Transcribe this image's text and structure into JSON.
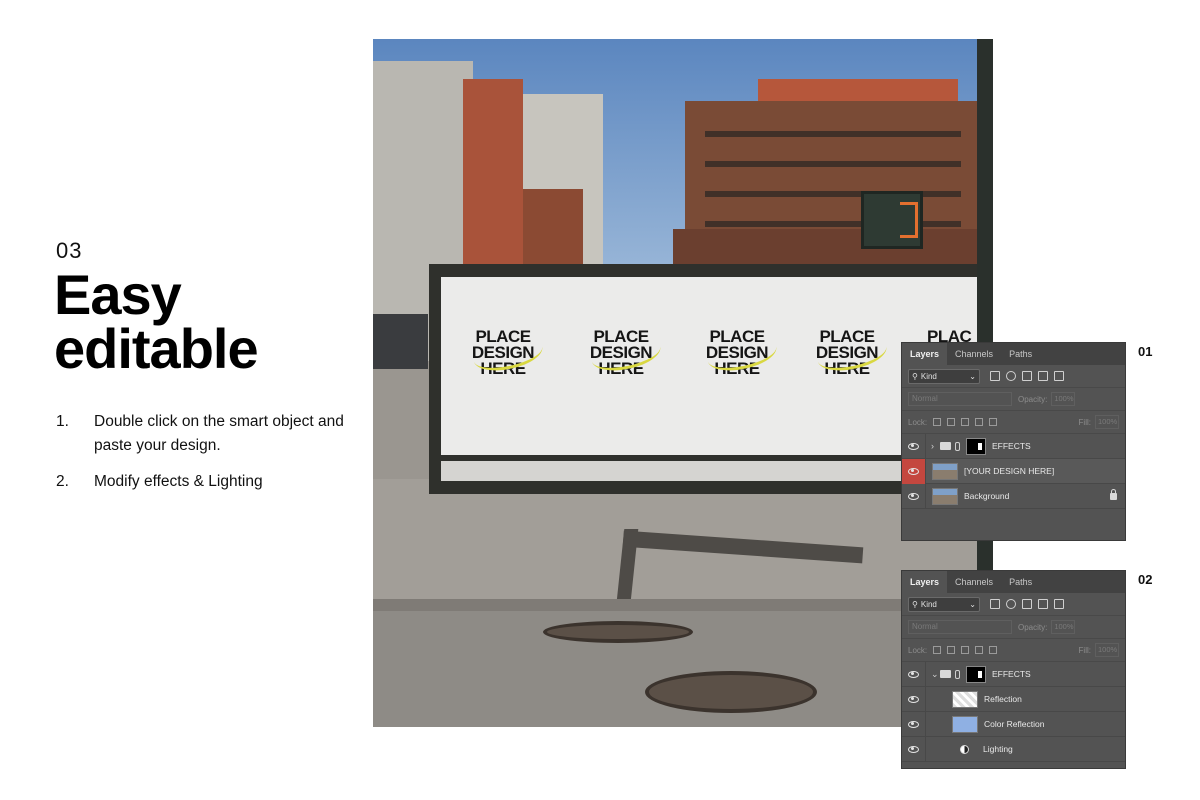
{
  "intro": {
    "step_number": "03",
    "headline_line1": "Easy",
    "headline_line2": "editable"
  },
  "steps": [
    {
      "num": "1.",
      "text": "Double click on the smart object and paste your design."
    },
    {
      "num": "2.",
      "text": "Modify effects & Lighting"
    }
  ],
  "photo": {
    "posters": [
      {
        "line1": "PLACE",
        "line2": "DESIGN",
        "line3": "HERE",
        "scrawl": "your"
      },
      {
        "line1": "PLACE",
        "line2": "DESIGN",
        "line3": "HERE",
        "scrawl": "your"
      },
      {
        "line1": "PLACE",
        "line2": "DESIGN",
        "line3": "HERE",
        "scrawl": "your"
      },
      {
        "line1": "PLACE",
        "line2": "DESIGN",
        "line3": "HERE",
        "scrawl": "your"
      },
      {
        "line1": "PLAC",
        "line2": "",
        "line3": "",
        "scrawl": ""
      }
    ],
    "signal_digit": "3"
  },
  "panels": [
    {
      "label": "01",
      "tabs": [
        "Layers",
        "Channels",
        "Paths"
      ],
      "kind_label": "Kind",
      "blend_mode": "Normal",
      "opacity_label": "Opacity:",
      "opacity_value": "100%",
      "lock_label": "Lock:",
      "fill_label": "Fill:",
      "fill_value": "100%",
      "layers": [
        {
          "name": "EFFECTS",
          "type": "group-collapsed"
        },
        {
          "name": "[YOUR DESIGN HERE]",
          "type": "smart-object",
          "selected": true
        },
        {
          "name": "Background",
          "type": "background",
          "locked": true
        }
      ]
    },
    {
      "label": "02",
      "tabs": [
        "Layers",
        "Channels",
        "Paths"
      ],
      "kind_label": "Kind",
      "blend_mode": "Normal",
      "opacity_label": "Opacity:",
      "opacity_value": "100%",
      "lock_label": "Lock:",
      "fill_label": "Fill:",
      "fill_value": "100%",
      "layers": [
        {
          "name": "EFFECTS",
          "type": "group-expanded"
        },
        {
          "name": "Reflection",
          "type": "checker-layer"
        },
        {
          "name": "Color Reflection",
          "type": "color-layer"
        },
        {
          "name": "Lighting",
          "type": "adjustment-layer"
        }
      ]
    }
  ],
  "colors": {
    "panel_bg": "#535353",
    "selected_eye": "#c4473f",
    "scrawl": "#d9d841",
    "color_reflection": "#8fb0e3"
  }
}
